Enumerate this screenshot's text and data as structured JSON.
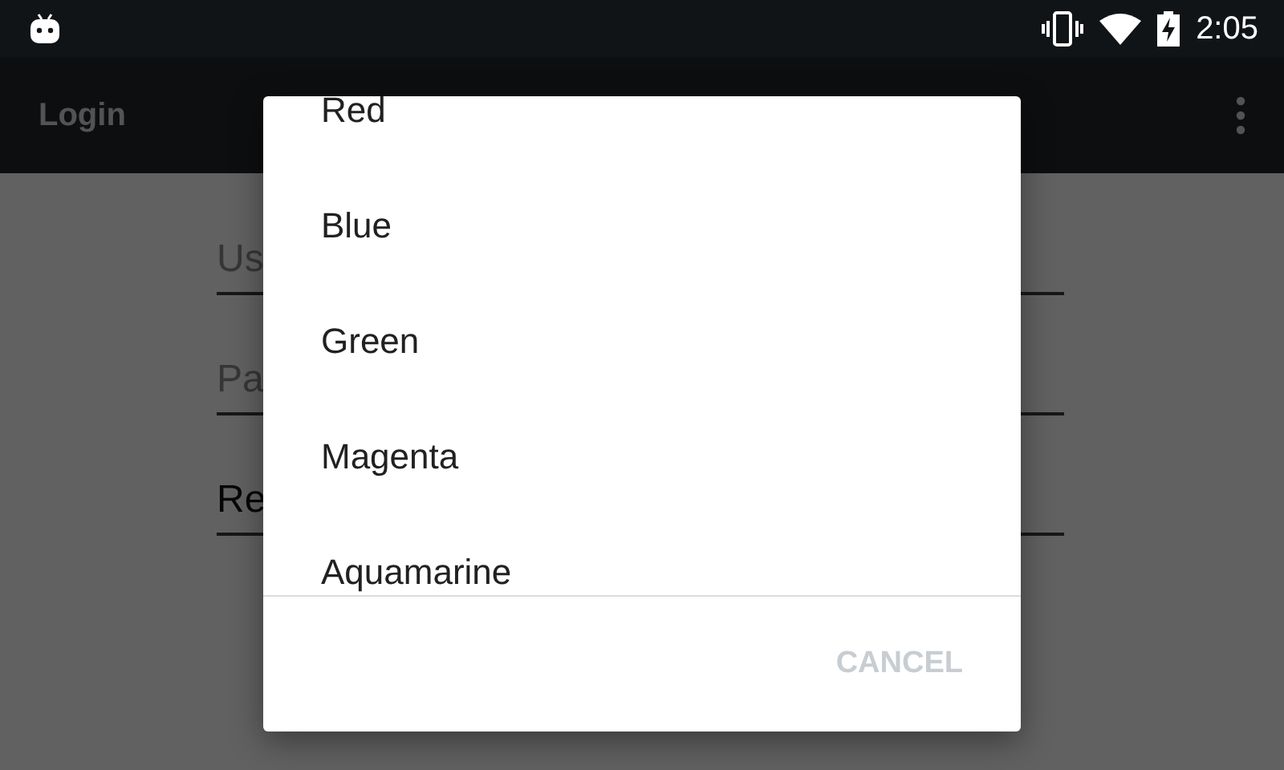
{
  "status_bar": {
    "time": "2:05"
  },
  "toolbar": {
    "title": "Login"
  },
  "form": {
    "fields": [
      {
        "placeholder": "Us"
      },
      {
        "placeholder": "Pa"
      },
      {
        "value": "Re"
      }
    ]
  },
  "dialog": {
    "items": [
      "Red",
      "Blue",
      "Green",
      "Magenta",
      "Aquamarine"
    ],
    "buttons": [
      {
        "label": "CANCEL",
        "disabled": true
      }
    ]
  }
}
